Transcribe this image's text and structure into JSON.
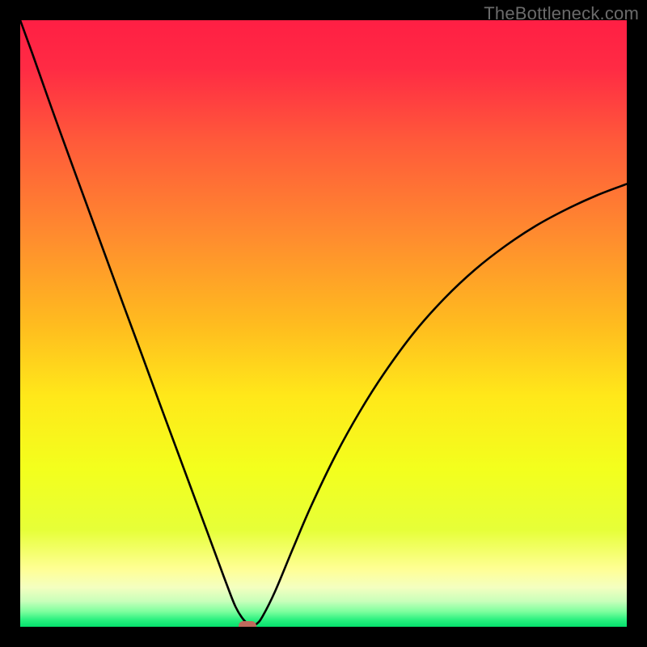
{
  "watermark": {
    "text": "TheBottleneck.com"
  },
  "colors": {
    "frame": "#000000",
    "curve": "#000000",
    "marker": "#bf6a5d",
    "gradient_stops": [
      {
        "offset": 0.0,
        "color": "#ff1f44"
      },
      {
        "offset": 0.08,
        "color": "#ff2b44"
      },
      {
        "offset": 0.2,
        "color": "#ff5a3a"
      },
      {
        "offset": 0.35,
        "color": "#ff8a2f"
      },
      {
        "offset": 0.5,
        "color": "#ffbb1f"
      },
      {
        "offset": 0.62,
        "color": "#ffe81a"
      },
      {
        "offset": 0.74,
        "color": "#f3ff1d"
      },
      {
        "offset": 0.84,
        "color": "#e6ff38"
      },
      {
        "offset": 0.905,
        "color": "#ffff95"
      },
      {
        "offset": 0.935,
        "color": "#f4ffc0"
      },
      {
        "offset": 0.958,
        "color": "#c8ffba"
      },
      {
        "offset": 0.975,
        "color": "#7dff9e"
      },
      {
        "offset": 0.988,
        "color": "#2cf180"
      },
      {
        "offset": 1.0,
        "color": "#05e06c"
      }
    ]
  },
  "chart_data": {
    "type": "line",
    "title": "",
    "xlabel": "",
    "ylabel": "",
    "xlim": [
      0,
      100
    ],
    "ylim": [
      0,
      100
    ],
    "grid": false,
    "series": [
      {
        "name": "bottleneck-curve",
        "x": [
          0,
          2,
          5,
          8,
          11,
          14,
          17,
          20,
          23,
          26,
          29,
          32,
          34,
          35.5,
          36.8,
          38,
          39,
          40,
          42,
          45,
          48,
          52,
          56,
          60,
          65,
          70,
          75,
          80,
          85,
          90,
          95,
          100
        ],
        "y": [
          100,
          94.5,
          86,
          77.7,
          69.5,
          61.3,
          53.1,
          45,
          36.8,
          28.7,
          20.6,
          12.5,
          7.1,
          3.3,
          1.2,
          0.2,
          0.5,
          1.8,
          5.8,
          13,
          20,
          28.3,
          35.5,
          41.8,
          48.6,
          54.2,
          58.9,
          62.8,
          66.1,
          68.8,
          71.1,
          73
        ]
      }
    ],
    "annotations": [
      {
        "name": "minimum-marker",
        "x": 37.5,
        "y": 0.2
      }
    ]
  }
}
